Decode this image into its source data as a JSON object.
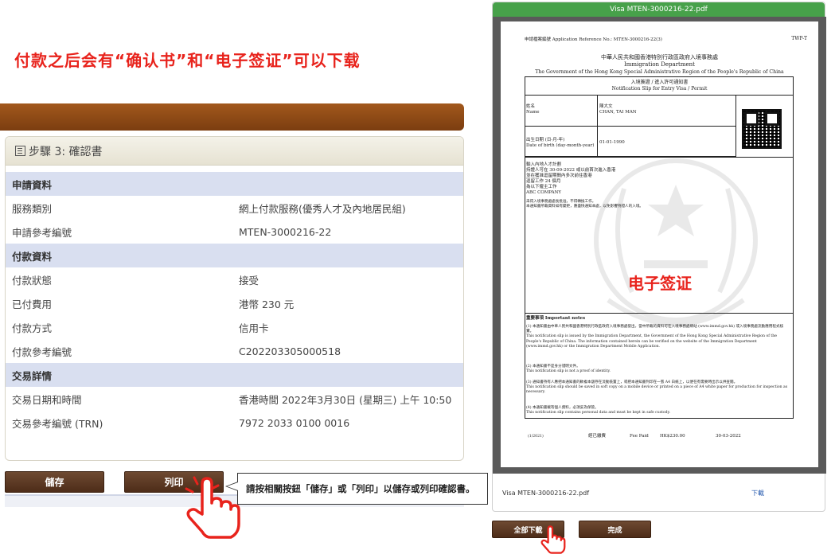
{
  "headline": "付款之后会有“确认书”和“电子签证”可以下载",
  "panel": {
    "title": "步驟 3: 確認書",
    "sections": [
      {
        "label": "申請資料",
        "rows": [
          {
            "key": "服務類別",
            "value": "網上付款服務(優秀人才及內地居民組)"
          },
          {
            "key": "申請參考編號",
            "value": "MTEN-3000216-22"
          }
        ]
      },
      {
        "label": "付款資料",
        "rows": [
          {
            "key": "付款狀態",
            "value": "接受"
          },
          {
            "key": "已付費用",
            "value": "港幣 230 元"
          },
          {
            "key": "付款方式",
            "value": "信用卡"
          },
          {
            "key": "付款參考編號",
            "value": "C202203305000518"
          }
        ]
      },
      {
        "label": "交易詳情",
        "rows": [
          {
            "key": "交易日期和時間",
            "value": "香港時間 2022年3月30日 (星期三) 上午 10:50"
          },
          {
            "key": "交易參考編號 (TRN)",
            "value": "7972 2033 0100 0016"
          }
        ]
      }
    ]
  },
  "buttons": {
    "save": "儲存",
    "print": "列印",
    "download_all": "全部下載",
    "done": "完成"
  },
  "callout": "請按相關按鈕「儲存」或「列印」以儲存或列印確認書。",
  "viewer": {
    "title": "Visa MTEN-3000216-22.pdf",
    "filename": "Visa MTEN-3000216-22.pdf",
    "download": "下載"
  },
  "document": {
    "ref": "申請檔案編號 Application Reference No.:  MTEN-3000216-22(3)",
    "form": "TWP-T",
    "gov_cn": "中華人民共和國香港特別行政區政府入境事務處",
    "dept": "Immigration Department",
    "gov_en": "The Government of the Hong Kong Special Administrative Region of the People's Republic of China",
    "slip_cn": "入境簽證 / 進入許可通知書",
    "slip_en": "Notification Slip for Entry Visa / Permit",
    "name_label": "姓名\nName",
    "name_value": "陳大文\nCHAN, TAI MAN",
    "dob_label": "出生日期 (日-月-年)\nDate of birth (day-month-year)",
    "dob_value": "01-01-1990",
    "conditions": "輸入內地人才計劃\n持證人可在 30-09-2022 或以前首次進入香港\n並在獲准逗留期間內多次前往香港\n逗留工作 24 個月\n為以下僱主工作\nABC COMPANY",
    "conditions_note": "未得入境事務處處長批准，不得轉換工作。\n本通知書所載資料如有變更，應盡快通知本處，以免影響持證人的入境。",
    "stamp": "电子签证",
    "notes_title": "重要事項    Important notes",
    "notes": [
      "(1) 本通知書由中華人民共和國香港特別行政區政府入境事務處發出，當中所載的資料可在入境事務處網站 (www.immd.gov.hk) 或入境事務處流動應用程式核實。\nThis notification slip is issued by the Immigration Department, the Government of the Hong Kong Special Administrative Region of the People's Republic of China. The information contained herein can be verified on the website of the Immigration Department (www.immd.gov.hk) or the Immigration Department Mobile Application.",
      "(2) 本通知書不是身分證明文件。\nThis notification slip is not a proof of identity.",
      "(3) 通知書持有人應把本通知書的軟複本儲存在流動裝置上，或把本通知書列印在一張 A4 白紙上，以便在有需要時出示以供查閱。\nThis notification slip should be saved in soft copy on a mobile device or printed on a piece of A4 white paper for production for inspection as necessary.",
      "(4) 本通知書載有個人資料，必須妥為保管。\nThis notification slip contains personal data and must be kept in safe custody."
    ],
    "footer_code": "(1/2021)",
    "fee_cn": "經已繳費",
    "fee_en": "Fee Paid",
    "fee_amount": "HK$230.00",
    "fee_date": "30-03-2022"
  },
  "colors": {
    "headline": "#e8231c",
    "brown": "#6e4a32",
    "green": "#47a14a",
    "section": "#d9dff0"
  },
  "icons": [
    "panel-icon",
    "hand-pointer-icon",
    "qr-code-icon",
    "emblem-watermark-icon"
  ]
}
